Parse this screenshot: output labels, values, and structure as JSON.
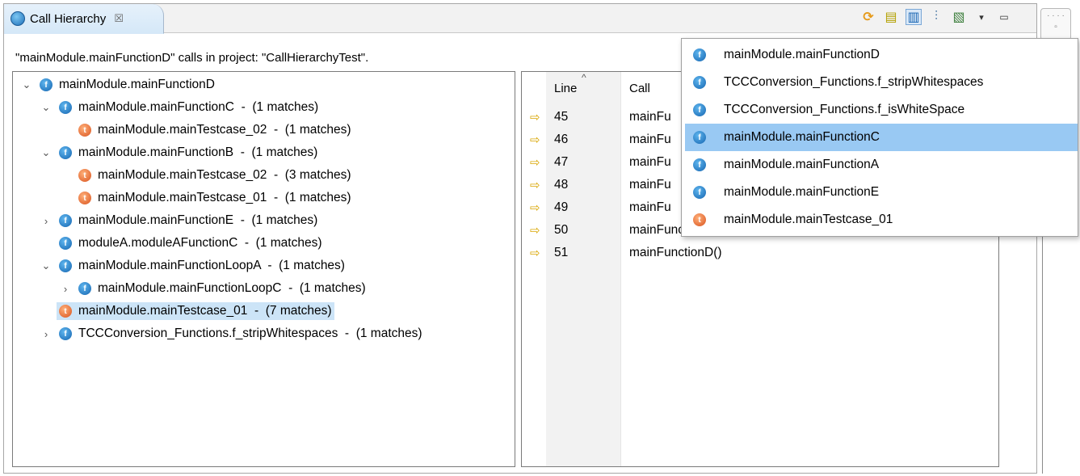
{
  "view": {
    "tab_label": "Call Hierarchy",
    "tab_close_glyph": "☒",
    "tab_icon": "call-hierarchy-icon"
  },
  "toolbar": {
    "icons": [
      "refresh-icon",
      "document-icon",
      "layout-icon",
      "hierarchy-icon",
      "history-icon",
      "view-menu-icon",
      "minimize-icon"
    ],
    "glyphs": {
      "refresh": "⟳",
      "document": "▤",
      "layout": "▥",
      "hierarchy": "⫶",
      "history": "▧",
      "view_menu": "▾",
      "minimize": "▭"
    }
  },
  "description": "\"mainModule.mainFunctionD\" calls in project: \"CallHierarchyTest\".",
  "tree": {
    "rows": [
      {
        "arrow": "⌄",
        "icon": "fn",
        "text": "mainModule.mainFunctionD",
        "selected": false
      },
      {
        "arrow": "⌄",
        "icon": "fn",
        "text": "mainModule.mainFunctionC  -  (1 matches)",
        "selected": false
      },
      {
        "arrow": "",
        "icon": "tc",
        "text": "mainModule.mainTestcase_02  -  (1 matches)",
        "selected": false
      },
      {
        "arrow": "⌄",
        "icon": "fn",
        "text": "mainModule.mainFunctionB  -  (1 matches)",
        "selected": false
      },
      {
        "arrow": "",
        "icon": "tc",
        "text": "mainModule.mainTestcase_02  -  (3 matches)",
        "selected": false
      },
      {
        "arrow": "",
        "icon": "tc",
        "text": "mainModule.mainTestcase_01  -  (1 matches)",
        "selected": false
      },
      {
        "arrow": "›",
        "icon": "fn",
        "text": "mainModule.mainFunctionE  -  (1 matches)",
        "selected": false
      },
      {
        "arrow": "",
        "icon": "fn",
        "text": "moduleA.moduleAFunctionC  -  (1 matches)",
        "selected": false
      },
      {
        "arrow": "⌄",
        "icon": "fn",
        "text": "mainModule.mainFunctionLoopA  -  (1 matches)",
        "selected": false
      },
      {
        "arrow": "›",
        "icon": "fn",
        "text": "mainModule.mainFunctionLoopC  -  (1 matches)",
        "selected": false
      },
      {
        "arrow": "",
        "icon": "tc",
        "text": "mainModule.mainTestcase_01  -  (7 matches)",
        "selected": true
      },
      {
        "arrow": "›",
        "icon": "fn",
        "text": "TCCConversion_Functions.f_stripWhitespaces  -  (1 matches)",
        "selected": false
      }
    ],
    "icon_glyph": {
      "fn": "f",
      "tc": "t"
    }
  },
  "table": {
    "headers": {
      "line": "Line",
      "call": "Call",
      "sort_indicator": "^"
    },
    "marker_glyph": "⇨",
    "rows": [
      {
        "line": "45",
        "call": "mainFu"
      },
      {
        "line": "46",
        "call": "mainFu"
      },
      {
        "line": "47",
        "call": "mainFu"
      },
      {
        "line": "48",
        "call": "mainFu"
      },
      {
        "line": "49",
        "call": "mainFu"
      },
      {
        "line": "50",
        "call": "mainFunctionD()"
      },
      {
        "line": "51",
        "call": "mainFunctionD()"
      }
    ]
  },
  "minimized": {
    "dots": "· · · ·",
    "restore_glyph": "▫"
  },
  "history_dropdown": {
    "items": [
      {
        "icon": "fn",
        "text": "mainModule.mainFunctionD",
        "selected": false
      },
      {
        "icon": "fn",
        "text": "TCCConversion_Functions.f_stripWhitespaces",
        "selected": false
      },
      {
        "icon": "fn",
        "text": "TCCConversion_Functions.f_isWhiteSpace",
        "selected": false
      },
      {
        "icon": "fn",
        "text": "mainModule.mainFunctionC",
        "selected": true
      },
      {
        "icon": "fn",
        "text": "mainModule.mainFunctionA",
        "selected": false
      },
      {
        "icon": "fn",
        "text": "mainModule.mainFunctionE",
        "selected": false
      },
      {
        "icon": "tc",
        "text": "mainModule.mainTestcase_01",
        "selected": false
      }
    ]
  },
  "colors": {
    "selection": "#cce4f7",
    "dropdown_selection": "#99c9f3",
    "function_icon": "#1565b0",
    "testcase_icon": "#d9531e",
    "marker_arrow": "#d9a600"
  }
}
